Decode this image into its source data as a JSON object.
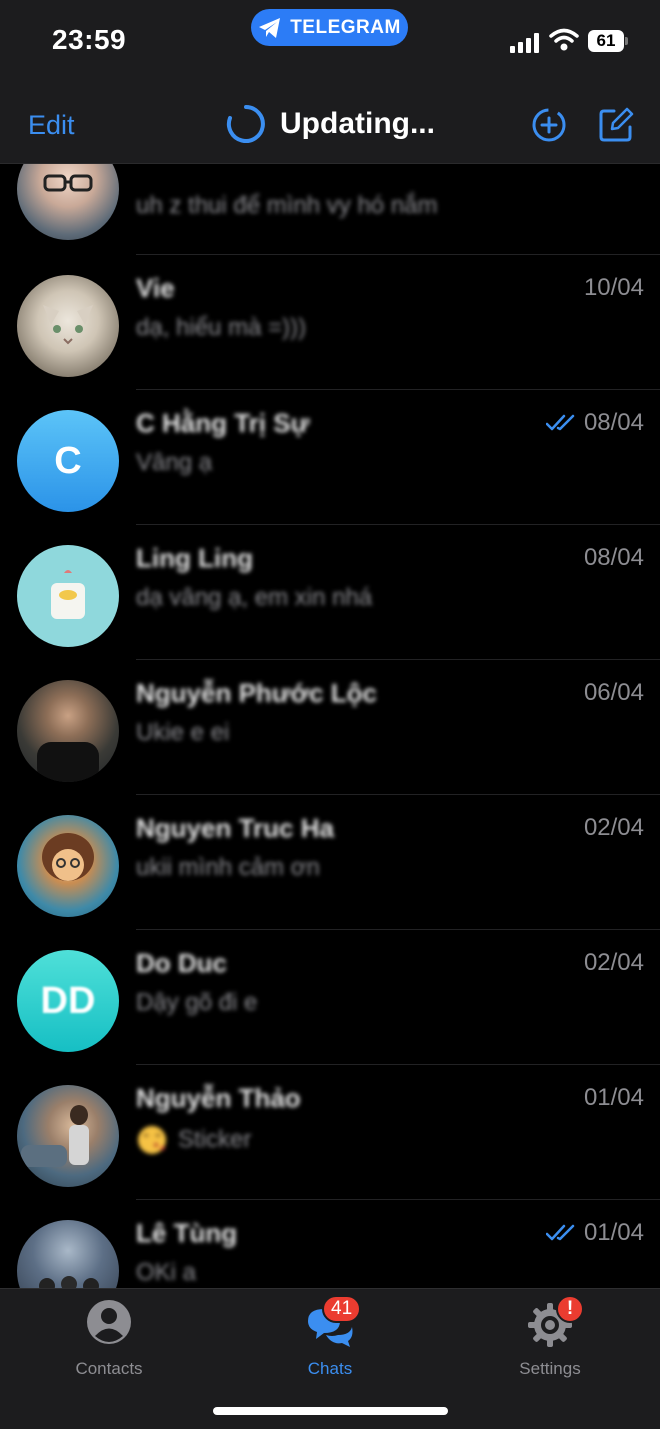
{
  "status_bar": {
    "time": "23:59",
    "app_pill": "TELEGRAM",
    "battery": "61",
    "icons": [
      "telegram-plane-icon",
      "signal-icon",
      "wifi-icon",
      "battery-icon"
    ]
  },
  "header": {
    "edit": "Edit",
    "title": "Updating...",
    "accent_color": "#3b8ef0",
    "icons": [
      "spinner-icon",
      "new-story-icon",
      "compose-icon"
    ]
  },
  "chats": [
    {
      "name": "",
      "preview": "uh z thui để mình vy hó nắm",
      "date": "",
      "avatar_initials": "",
      "read": false
    },
    {
      "name": "Vie",
      "preview": "dạ, hiểu mà =)))",
      "date": "10/04",
      "avatar_initials": "",
      "read": false
    },
    {
      "name": "C Hằng Trị Sự",
      "preview": "Vâng ạ",
      "date": "08/04",
      "avatar_initials": "C",
      "read": true
    },
    {
      "name": "Ling Ling",
      "preview": "dạ vâng ạ, em xin nhá",
      "date": "08/04",
      "avatar_initials": "",
      "read": false
    },
    {
      "name": "Nguyễn Phước Lộc",
      "preview": "Ukie e ei",
      "date": "06/04",
      "avatar_initials": "",
      "read": false
    },
    {
      "name": "Nguyen Truc Ha",
      "preview": "ukii mình cảm ơn",
      "date": "02/04",
      "avatar_initials": "",
      "read": false
    },
    {
      "name": "Do Duc",
      "preview": "Dậy gõ đi e",
      "date": "02/04",
      "avatar_initials": "DD",
      "read": false
    },
    {
      "name": "Nguyễn Thảo",
      "preview": "Sticker",
      "date": "01/04",
      "avatar_initials": "",
      "read": false
    },
    {
      "name": "Lê Tùng",
      "preview": "OKi a",
      "date": "01/04",
      "avatar_initials": "",
      "read": true
    }
  ],
  "tabs": {
    "contacts": "Contacts",
    "chats": "Chats",
    "chats_badge": "41",
    "settings": "Settings",
    "settings_badge": "!"
  }
}
